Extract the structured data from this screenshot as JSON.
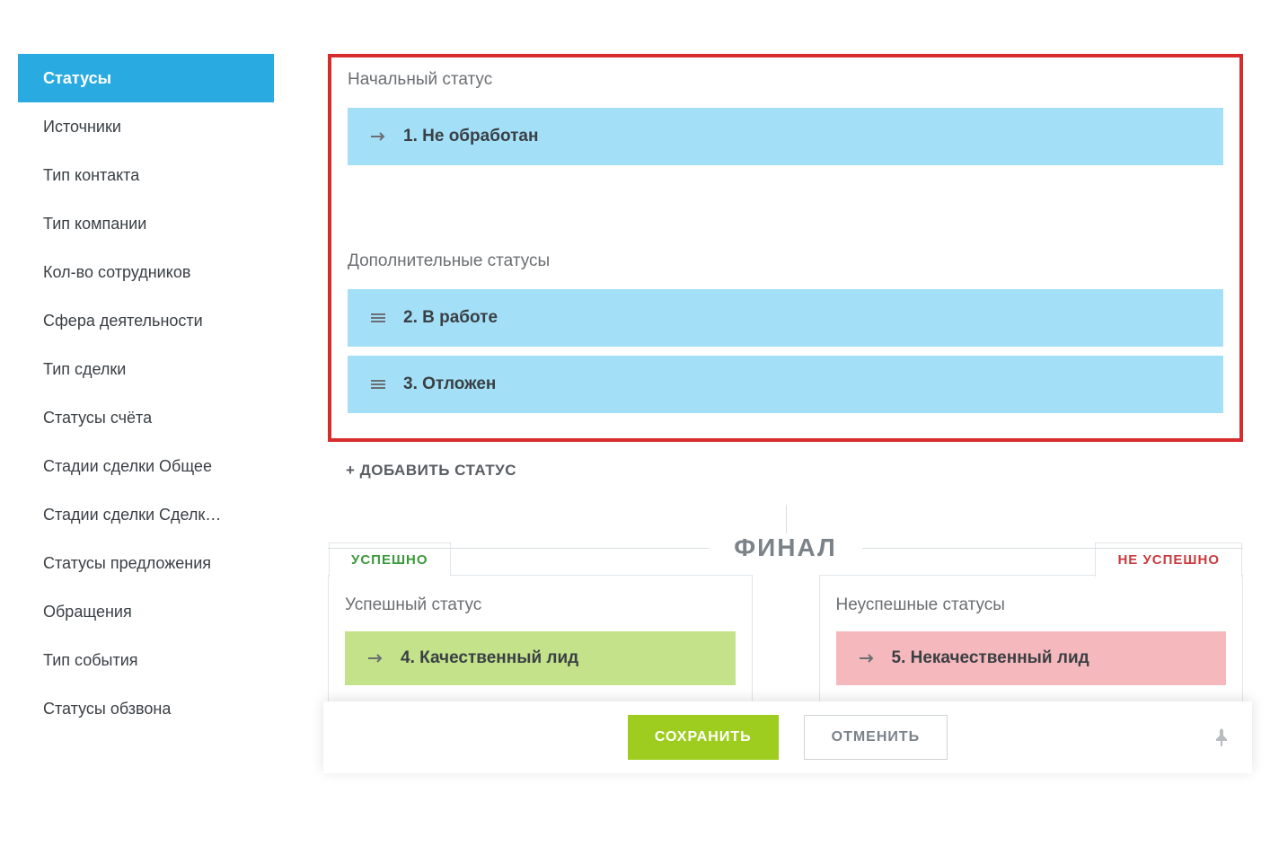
{
  "sidebar": {
    "items": [
      {
        "label": "Статусы",
        "active": true
      },
      {
        "label": "Источники",
        "active": false
      },
      {
        "label": "Тип контакта",
        "active": false
      },
      {
        "label": "Тип компании",
        "active": false
      },
      {
        "label": "Кол-во сотрудников",
        "active": false
      },
      {
        "label": "Сфера деятельности",
        "active": false
      },
      {
        "label": "Тип сделки",
        "active": false
      },
      {
        "label": "Статусы счёта",
        "active": false
      },
      {
        "label": "Стадии сделки Общее",
        "active": false
      },
      {
        "label": "Стадии сделки Сделк…",
        "active": false
      },
      {
        "label": "Статусы предложения",
        "active": false
      },
      {
        "label": "Обращения",
        "active": false
      },
      {
        "label": "Тип события",
        "active": false
      },
      {
        "label": "Статусы обзвона",
        "active": false
      }
    ]
  },
  "sections": {
    "initial_title": "Начальный статус",
    "additional_title": "Дополнительные статусы",
    "add_status_label": "+ ДОБАВИТЬ СТАТУС"
  },
  "statuses": {
    "initial": {
      "label": "1. Не обработан"
    },
    "additional": [
      {
        "label": "2. В работе"
      },
      {
        "label": "3. Отложен"
      }
    ]
  },
  "final": {
    "heading": "ФИНАЛ",
    "success_tab": "УСПЕШНО",
    "fail_tab": "НЕ УСПЕШНО",
    "success_title": "Успешный статус",
    "fail_title": "Неуспешные статусы",
    "success_status": {
      "label": "4. Качественный лид"
    },
    "fail_status": {
      "label": "5. Некачественный лид"
    }
  },
  "footer": {
    "save": "СОХРАНИТЬ",
    "cancel": "ОТМЕНИТЬ"
  },
  "colors": {
    "accent": "#29abe2",
    "status_bg": "#a3e0f8",
    "success_bg": "#c3e28a",
    "fail_bg": "#f5b9bd",
    "save_btn": "#9ecd1f",
    "highlight_border": "#d72c2c"
  }
}
